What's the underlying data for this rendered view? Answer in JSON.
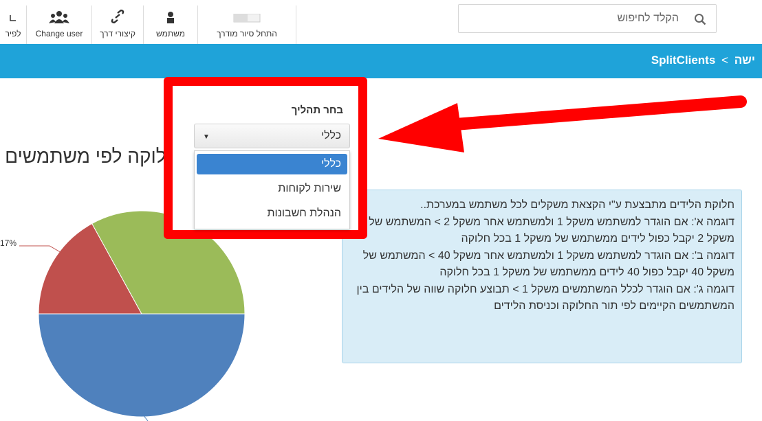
{
  "toolbar": {
    "items": [
      {
        "label": "לפיר",
        "icon": "exit-icon"
      },
      {
        "label": "Change user",
        "icon": "users-icon"
      },
      {
        "label": "קיצורי דרך",
        "icon": "link-icon"
      },
      {
        "label": "משתמש",
        "icon": "user-icon"
      },
      {
        "label": "התחל סיור מודרך",
        "icon": "tour-icon"
      }
    ]
  },
  "search": {
    "placeholder": "הקלד לחיפוש"
  },
  "breadcrumb": {
    "first": "SplitClients",
    "separator": "<",
    "second": "ישה"
  },
  "page_heading": "חלוקה לפי משתמשים לזמן המשתמשים לזמן ה",
  "pie": {
    "label": "17%",
    "colors": [
      "#4f81bd",
      "#c0504d",
      "#9bbb59"
    ],
    "fractions": [
      0.5,
      0.17,
      0.33
    ]
  },
  "info": {
    "lines": [
      "חלוקת הלידים מתבצעת ע\"י הקצאת משקלים לכל משתמש במערכת..",
      "דוגמה א': אם הוגדר למשתמש משקל 1 ולמשתמש אחר משקל 2 > המשתמש של משקל 2 יקבל כפול לידים ממשתמש של משקל 1 בכל חלוקה",
      "דוגמה ב': אם הוגדר למשתמש משקל 1 ולמשתמש אחר משקל 40 > המשתמש של משקל 40 יקבל כפול 40 לידים ממשתמש של משקל 1 בכל חלוקה",
      "דוגמה ג': אם הוגדר לכלל המשתמשים משקל 1 > תבוצע חלוקה שווה של הלידים בין המשתמשים הקיימים לפי תור החלוקה וכניסת הלידים"
    ]
  },
  "process": {
    "label": "בחר תהליך",
    "selected": "כללי",
    "options": [
      "כללי",
      "שירות לקוחות",
      "הנהלת חשבונות"
    ]
  },
  "colors": {
    "highlight": "#ff0000",
    "bar": "#1fa3d9",
    "selected_option": "#3a84d1"
  }
}
